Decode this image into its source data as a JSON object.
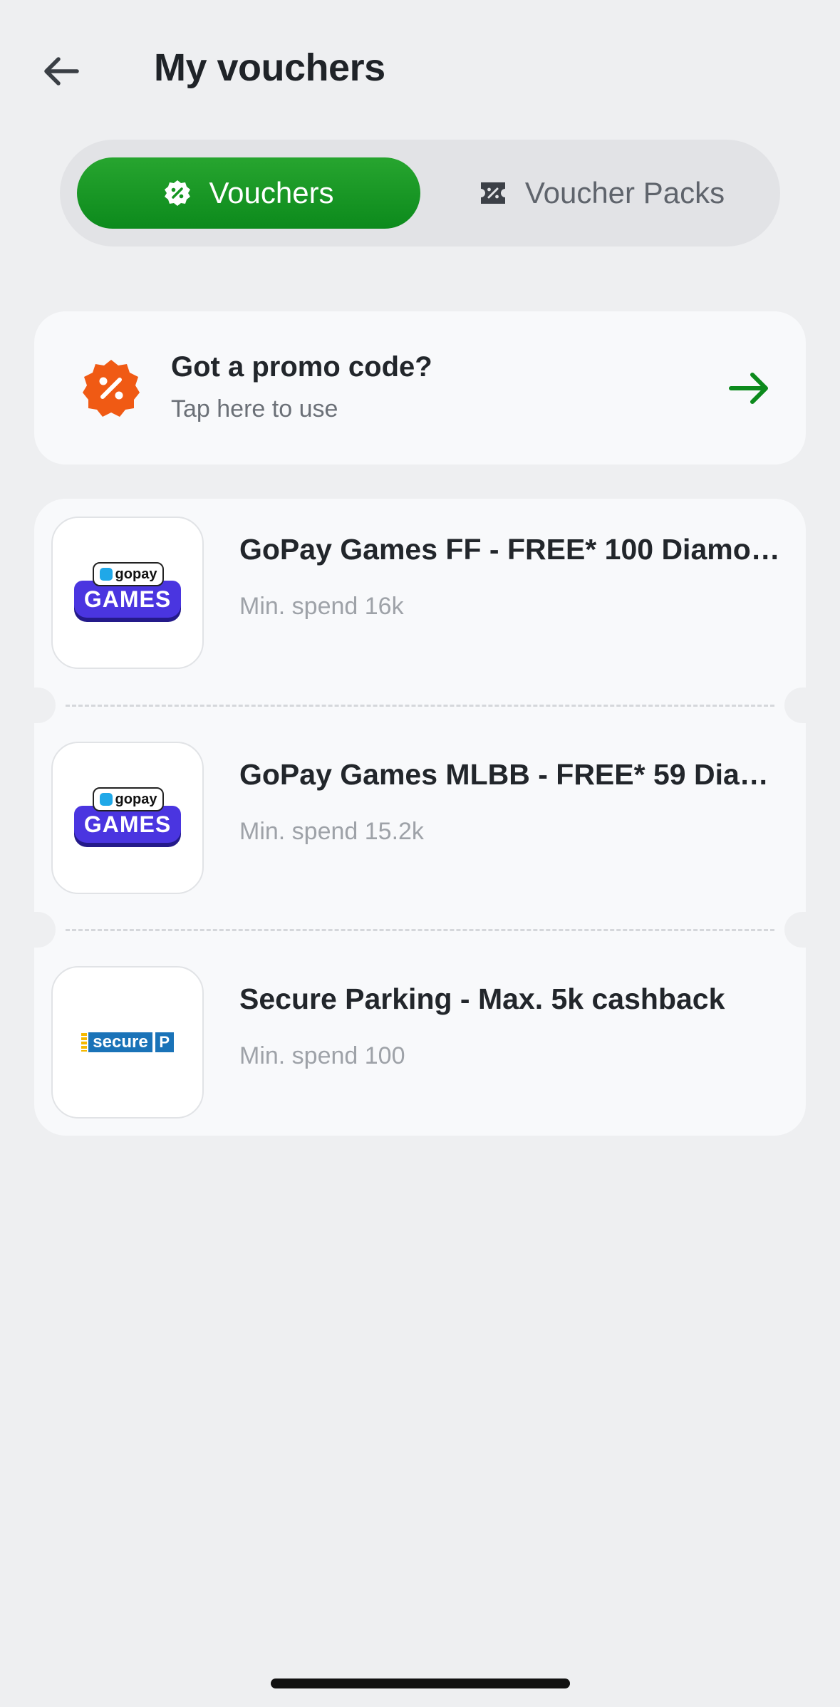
{
  "header": {
    "title": "My vouchers",
    "back_icon": "arrow-left-icon"
  },
  "tabs": [
    {
      "label": "Vouchers",
      "icon": "percent-badge-icon",
      "active": true
    },
    {
      "label": "Voucher Packs",
      "icon": "ticket-percent-icon",
      "active": false
    }
  ],
  "promo": {
    "title": "Got a promo code?",
    "subtitle": "Tap here to use",
    "icon": "percent-badge-icon",
    "arrow_icon": "arrow-right-icon"
  },
  "vouchers": [
    {
      "title": "GoPay Games FF - FREE* 100 Diamo…",
      "subtitle": "Min. spend 16k",
      "logo": "gopay-games-logo",
      "logo_top": "gopay",
      "logo_main": "GAMES"
    },
    {
      "title": "GoPay Games MLBB - FREE* 59 Dia…",
      "subtitle": "Min. spend 15.2k",
      "logo": "gopay-games-logo",
      "logo_top": "gopay",
      "logo_main": "GAMES"
    },
    {
      "title": "Secure Parking - Max. 5k cashback",
      "subtitle": "Min. spend 100",
      "logo": "secure-parking-logo",
      "logo_main": "secure",
      "logo_mark": "P"
    }
  ],
  "colors": {
    "accent_green": "#0c8a1c",
    "promo_orange": "#f05a14",
    "background": "#eeeff1"
  }
}
